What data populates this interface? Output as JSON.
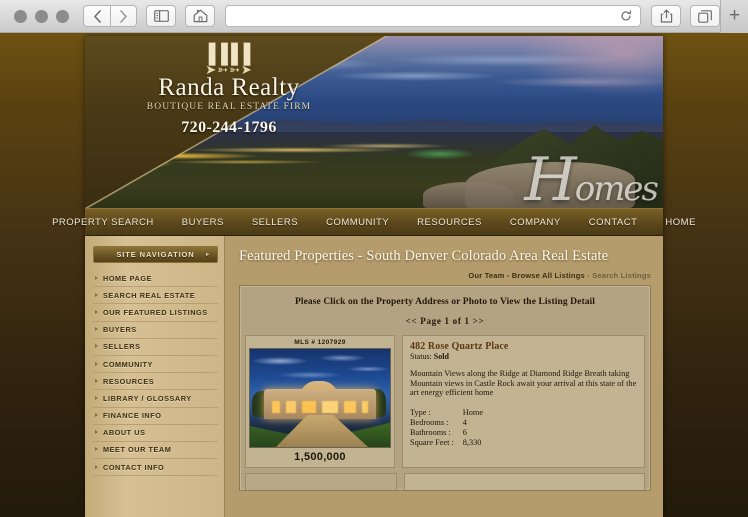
{
  "browser": {
    "url_value": "",
    "url_placeholder": "",
    "back_icon": "chevron-left-icon",
    "forward_icon": "chevron-right-icon",
    "sidebar_icon": "sidebar-toggle-icon",
    "home_icon": "home-icon",
    "reload_icon": "reload-icon",
    "share_icon": "share-icon",
    "tabs_icon": "tab-overview-icon",
    "newtab_label": "+"
  },
  "banner": {
    "logo_ornament": "➤➳➳➤",
    "logo_crest": "▐▐ ▌▌",
    "brand": "Randa Realty",
    "tagline": "BOUTIQUE REAL ESTATE FIRM",
    "phone": "720-244-1796",
    "script_first": "H",
    "script_rest": "omes"
  },
  "topnav": {
    "items": [
      {
        "label": "PROPERTY SEARCH"
      },
      {
        "label": "BUYERS"
      },
      {
        "label": "SELLERS"
      },
      {
        "label": "COMMUNITY"
      },
      {
        "label": "RESOURCES"
      },
      {
        "label": "COMPANY"
      },
      {
        "label": "CONTACT"
      },
      {
        "label": "HOME"
      }
    ]
  },
  "sidebar": {
    "header": "SITE NAVIGATION",
    "header_chevron": "▸",
    "items": [
      {
        "label": "HOME PAGE"
      },
      {
        "label": "SEARCH REAL ESTATE"
      },
      {
        "label": "OUR FEATURED LISTINGS"
      },
      {
        "label": "BUYERS"
      },
      {
        "label": "SELLERS"
      },
      {
        "label": "COMMUNITY"
      },
      {
        "label": "RESOURCES"
      },
      {
        "label": "LIBRARY / GLOSSARY"
      },
      {
        "label": "FINANCE INFO"
      },
      {
        "label": "ABOUT US"
      },
      {
        "label": "MEET OUR TEAM"
      },
      {
        "label": "CONTACT INFO"
      }
    ]
  },
  "main": {
    "page_title": "Featured Properties - South Denver Colorado Area Real Estate",
    "crumb_team": "Our Team",
    "crumb_sep1": " - ",
    "crumb_browse": "Browse All Listings",
    "crumb_sep2": " - ",
    "crumb_search": "Search Listings",
    "panel_note": "Please Click on the Property Address or Photo to View the Listing Detail",
    "pager": "<<  Page 1 of 1  >>"
  },
  "listing": {
    "mls": "MLS # 1207929",
    "price": "1,500,000",
    "address": "482 Rose Quartz Place",
    "status_label": "Status:",
    "status_value": "Sold",
    "description": "Mountain Views along the Ridge at Diamond Ridge Breath taking Mountain views in Castle Rock await your arrival at this state of the art energy efficient home",
    "specs": [
      {
        "key": "Type :",
        "value": "Home"
      },
      {
        "key": "Bedrooms :",
        "value": "4"
      },
      {
        "key": "Bathrooms :",
        "value": "6"
      },
      {
        "key": "Square Feet :",
        "value": "8,330"
      }
    ]
  },
  "colors": {
    "page_bg_top": "#6e5212",
    "page_bg_bottom": "#241a0b",
    "site_bg": "#b49c6c",
    "nav_bg": "#5f4a1c",
    "sidebar_bg": "#d6c094",
    "panel_bg": "#b4a382",
    "address_link": "#5c3a10"
  }
}
